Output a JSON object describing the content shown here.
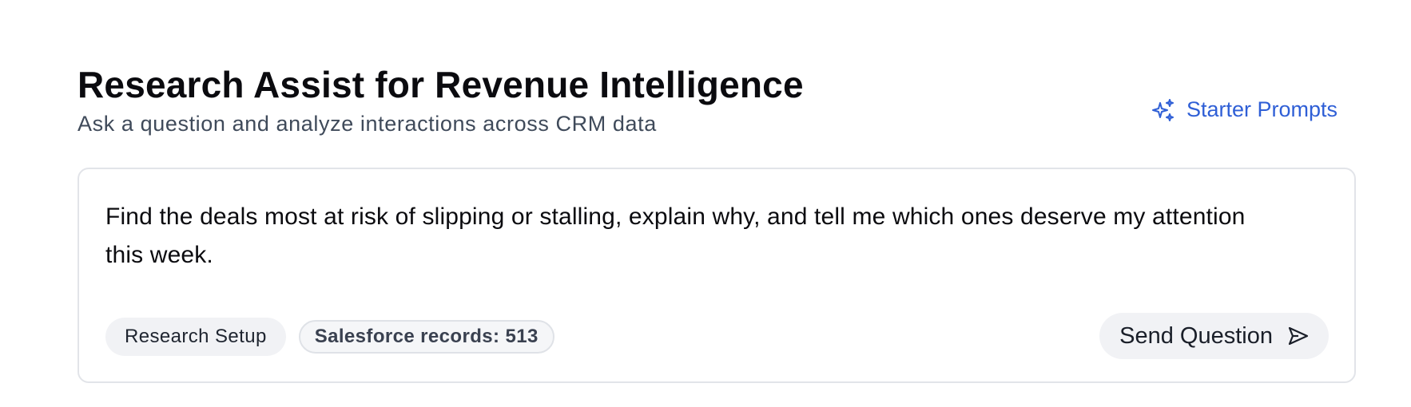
{
  "header": {
    "title": "Research Assist for Revenue Intelligence",
    "subtitle": "Ask a question and analyze interactions across CRM data"
  },
  "starter_prompts": {
    "label": "Starter Prompts",
    "icon": "sparkles-icon",
    "color": "#2f5fd6"
  },
  "composer": {
    "question": "Find the deals most at risk of slipping or stalling, explain why, and tell me which ones deserve my attention this week.",
    "research_setup_label": "Research Setup",
    "records_badge": "Salesforce records: 513",
    "send_label": "Send Question",
    "send_icon": "send-icon"
  }
}
